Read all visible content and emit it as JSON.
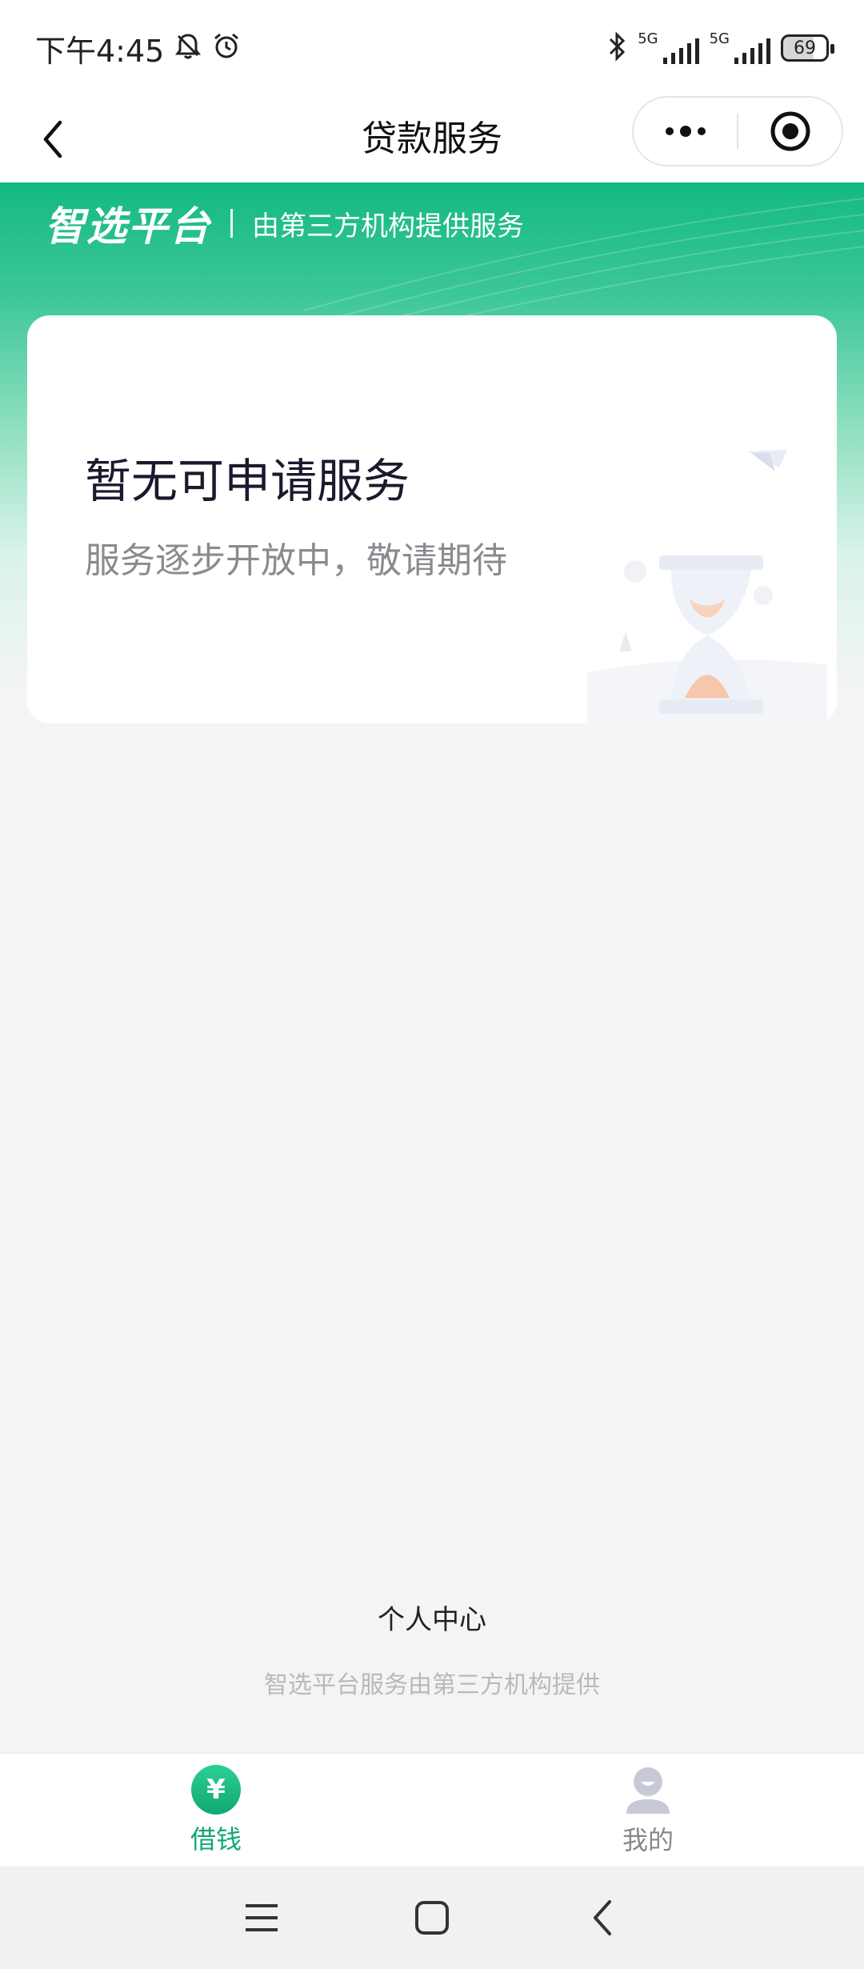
{
  "status_bar": {
    "time": "下午4:45",
    "signal_1": "5G",
    "signal_2": "5G",
    "battery": "69",
    "icons": [
      "notification-bell-icon",
      "alarm-clock-icon",
      "bluetooth-icon",
      "signal-icon",
      "battery-icon"
    ]
  },
  "nav": {
    "title": "贷款服务",
    "back_icon": "chevron-left-icon",
    "more_icon": "more-dots-icon",
    "close_icon": "target-circle-icon"
  },
  "hero": {
    "brand": "智选平台",
    "subtitle": "由第三方机构提供服务"
  },
  "card": {
    "title": "暂无可申请服务",
    "subtitle": "服务逐步开放中，敬请期待",
    "illustration": "hourglass-icon"
  },
  "footer": {
    "personal_center": "个人中心",
    "note": "智选平台服务由第三方机构提供"
  },
  "tab_bar": {
    "tabs": [
      {
        "label": "借钱",
        "icon": "yen-icon",
        "glyph": "¥",
        "active": true
      },
      {
        "label": "我的",
        "icon": "user-profile-icon",
        "active": false
      }
    ],
    "accent_color": "#11a873"
  },
  "system_nav": {
    "icons": [
      "menu-icon",
      "home-square-icon",
      "back-triangle-icon"
    ]
  },
  "colors": {
    "brand_green": "#14b982",
    "background": "#f4f4f4"
  }
}
